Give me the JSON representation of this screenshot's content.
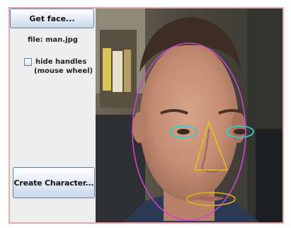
{
  "controls": {
    "get_face_label": "Get face...",
    "file_label": "file: man.jpg",
    "hide_handles_line1": "hide handles",
    "hide_handles_line2": "(mouse wheel)",
    "hide_handles_checked": false,
    "create_character_label": "Create Character..."
  },
  "colors": {
    "window_border": "#e7a9a9",
    "panel_bg": "#eeeeee",
    "face_outline": "#cc44cc",
    "eye_outline": "#33cccc",
    "nose_outline": "#e6c21a",
    "mouth_outline": "#e6b21a"
  }
}
